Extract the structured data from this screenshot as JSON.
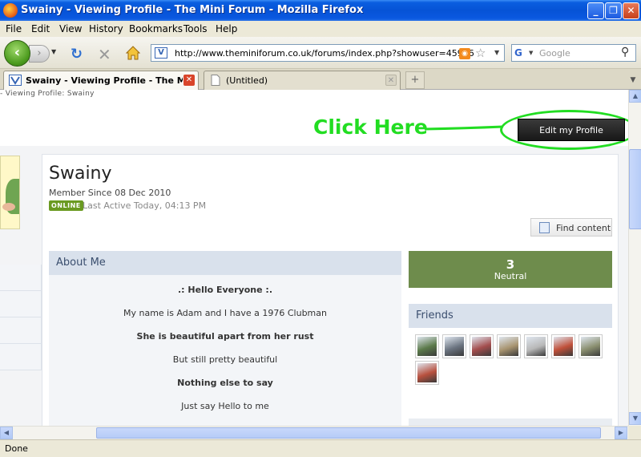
{
  "window": {
    "title": "Swainy - Viewing Profile - The Mini Forum - Mozilla Firefox",
    "minimize_glyph": "_",
    "maximize_glyph": "❐",
    "close_glyph": "✕"
  },
  "menu": [
    "File",
    "Edit",
    "View",
    "History",
    "Bookmarks",
    "Tools",
    "Help"
  ],
  "nav": {
    "back_glyph": "‹",
    "forward_glyph": "›",
    "reload_glyph": "↻",
    "stop_glyph": "✕",
    "url": "http://www.theminiforum.co.uk/forums/index.php?showuser=45986",
    "search_placeholder": "Google"
  },
  "tabs": [
    {
      "title": "Swainy - Viewing Profile - The Mi...",
      "active": true
    },
    {
      "title": "(Untitled)",
      "active": false
    }
  ],
  "page": {
    "breadcrumb": "- Viewing Profile: Swainy",
    "annotation": "Click Here",
    "edit_profile_label": "Edit my Profile",
    "profile_name": "Swainy",
    "member_since": "Member Since 08 Dec 2010",
    "online_badge": "ONLINE",
    "last_active": "Last Active Today, 04:13 PM",
    "find_content_label": "Find content",
    "about_title": "About Me",
    "about_lines": [
      {
        "text": ".: Hello Everyone :.",
        "bold": true
      },
      {
        "text": "My name is Adam and I have a 1976 Clubman",
        "bold": false
      },
      {
        "text": "She is beautiful apart from her rust",
        "bold": true
      },
      {
        "text": "But still pretty beautiful",
        "bold": false
      },
      {
        "text": "Nothing else to say",
        "bold": true
      },
      {
        "text": "Just say Hello to me",
        "bold": false
      }
    ],
    "reputation": {
      "value": "3",
      "label": "Neutral"
    },
    "friends_title": "Friends",
    "friends": [
      {
        "name": "friend-1",
        "color": "#5b7a4a"
      },
      {
        "name": "friend-2",
        "color": "#6b7480"
      },
      {
        "name": "friend-3",
        "color": "#a34d4d"
      },
      {
        "name": "friend-4",
        "color": "#a89470"
      },
      {
        "name": "friend-5",
        "color": "#b8b8b8"
      },
      {
        "name": "friend-6",
        "color": "#c0503a"
      },
      {
        "name": "friend-7",
        "color": "#8a8f70"
      },
      {
        "name": "friend-8",
        "color": "#b8503e"
      }
    ]
  },
  "status": "Done",
  "colors": {
    "annotation_green": "#22dd22",
    "online_green": "#6a9a21",
    "reputation_green": "#6e8c4c",
    "section_header": "#d9e1ec"
  }
}
